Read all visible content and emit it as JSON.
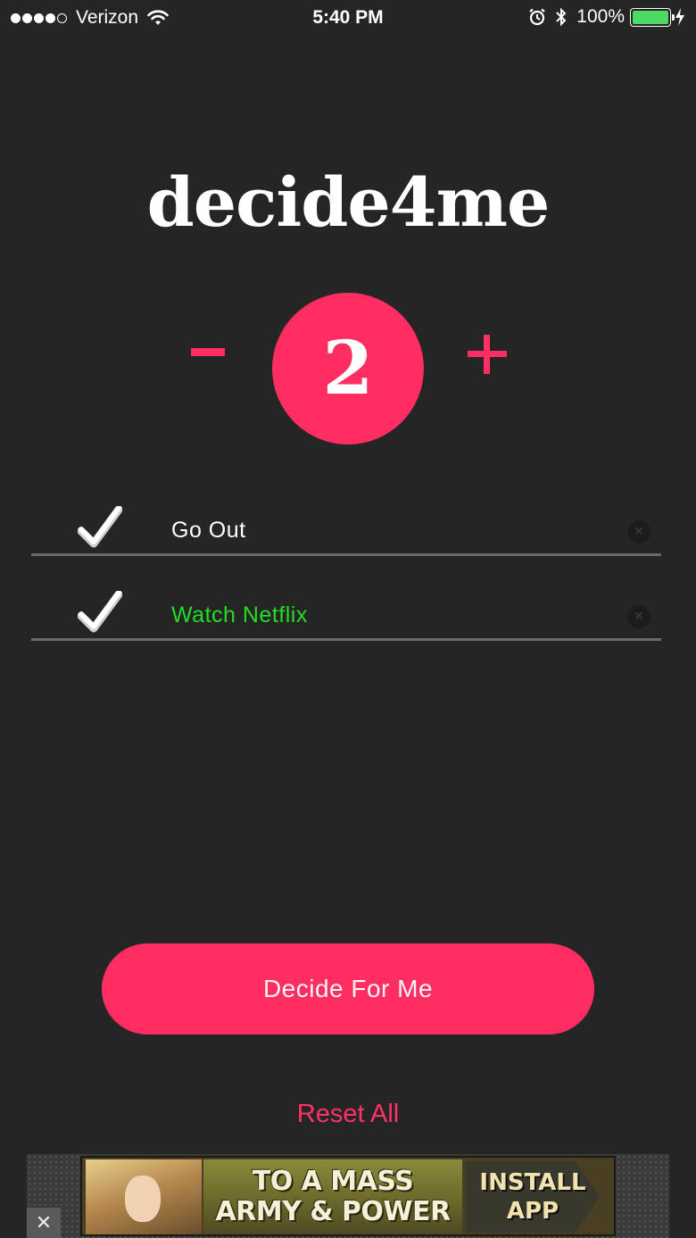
{
  "status_bar": {
    "carrier": "Verizon",
    "time": "5:40 PM",
    "battery": "100%",
    "signal_dots_filled": 4,
    "battery_level": 1.0,
    "battery_color": "#4cd964"
  },
  "app": {
    "title": "decide4me",
    "accent_color": "#ff2d62"
  },
  "counter": {
    "minus_label": "minus-icon",
    "plus_label": "plus-icon",
    "value": "2"
  },
  "options": [
    {
      "label": "Go Out",
      "checked": true,
      "icon": "checkmark-icon",
      "clear_icon": "clear-icon"
    },
    {
      "label": "Watch Netflix",
      "checked": true,
      "icon": "checkmark-icon",
      "clear_icon": "clear-icon",
      "label_color": "#22dd22"
    }
  ],
  "actions": {
    "decide_label": "Decide For Me",
    "reset_label": "Reset All"
  },
  "ad": {
    "headline_line1": "TO A MASS",
    "headline_line2": "ARMY & POWER",
    "install_line1": "INSTALL",
    "install_line2": "APP",
    "close_icon": "close-icon"
  }
}
